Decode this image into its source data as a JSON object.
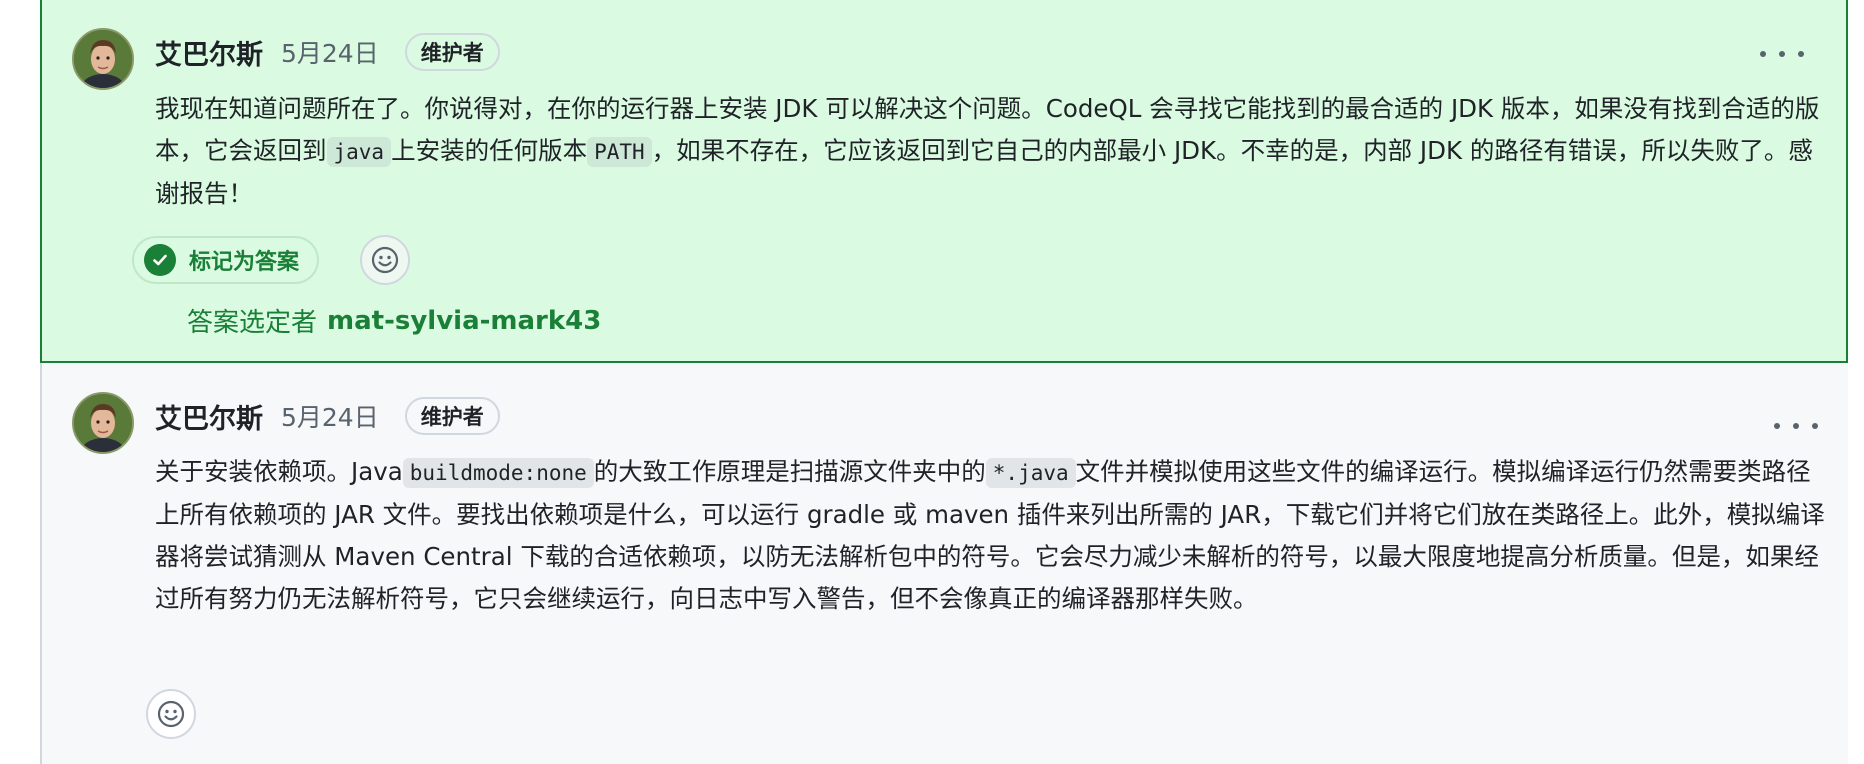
{
  "comments": [
    {
      "author": "艾巴尔斯",
      "date": "5月24日",
      "badge": "维护者",
      "body": [
        {
          "t": "我现在知道问题所在了。你说得对，在你的运行器上安装 JDK 可以解决这个问题。CodeQL 会寻找它能找到的最合适的 JDK 版本，如果没有找到合适的版本，它会返回到"
        },
        {
          "code": "java"
        },
        {
          "t": "上安装的任何版本"
        },
        {
          "code": "PATH"
        },
        {
          "t": "，如果不存在，它应该返回到它自己的内部最小 JDK。不幸的是，内部 JDK 的路径有错误，所以失败了。感谢报告！"
        }
      ],
      "mark_answer_label": "标记为答案",
      "answered_by_label": "答案选定者",
      "answered_by_user": "mat-sylvia-mark43"
    },
    {
      "author": "艾巴尔斯",
      "date": "5月24日",
      "badge": "维护者",
      "body": [
        {
          "t": "关于安装依赖项。Java"
        },
        {
          "code": "buildmode:none"
        },
        {
          "t": "的大致工作原理是扫描源文件夹中的"
        },
        {
          "code": "*.java"
        },
        {
          "t": "文件并模拟使用这些文件的编译运行。模拟编译运行仍然需要类路径上所有依赖项的 JAR 文件。要找出依赖项是什么，可以运行 gradle 或 maven 插件来列出所需的 JAR，下载它们并将它们放在类路径上。此外，模拟编译器将尝试猜测从 Maven Central 下载的合适依赖项，以防无法解析包中的符号。它会尽力减少未解析的符号，以最大限度地提高分析质量。但是，如果经过所有努力仍无法解析符号，它只会继续运行，向日志中写入警告，但不会像真正的编译器那样失败。"
        }
      ]
    }
  ],
  "colors": {
    "answer_bg": "#dafbe1",
    "answer_border": "#1a7f37",
    "comment_bg": "#f6f8fa",
    "muted_text": "#59636e"
  },
  "icons": [
    "avatar",
    "check-circle-icon",
    "smiley-icon",
    "kebab-horizontal-icon"
  ]
}
